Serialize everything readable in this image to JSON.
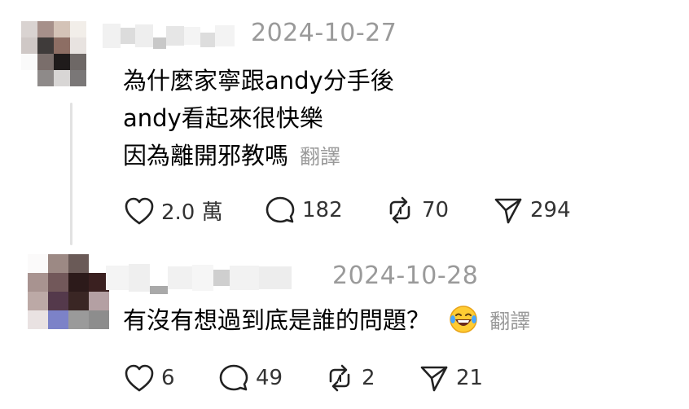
{
  "comments": [
    {
      "date": "2024-10-27",
      "lines": [
        "為什麼家寧跟andy分手後",
        "andy看起來很快樂",
        "因為離開邪教嗎"
      ],
      "translate_label": "翻譯",
      "actions": {
        "likes": "2.0 萬",
        "replies": "182",
        "reposts": "70",
        "shares": "294"
      }
    },
    {
      "date": "2024-10-28",
      "lines": [
        "有沒有想過到底是誰的問題？"
      ],
      "translate_label": "翻譯",
      "emoji": "laughing-tears",
      "actions": {
        "likes": "6",
        "replies": "49",
        "reposts": "2",
        "shares": "21"
      }
    }
  ],
  "icons": [
    "heart-icon",
    "comment-icon",
    "repost-icon",
    "share-icon"
  ],
  "colors": {
    "secondary_text": "#9a9a9a",
    "thread_line": "#e2e2e2",
    "primary_text": "#000000"
  }
}
